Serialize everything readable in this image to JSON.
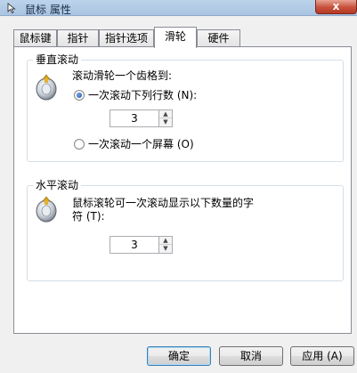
{
  "window": {
    "title": "鼠标 属性",
    "close_label": "x"
  },
  "tabs": [
    {
      "label": "鼠标键"
    },
    {
      "label": "指针"
    },
    {
      "label": "指针选项"
    },
    {
      "label": "滑轮",
      "active": true
    },
    {
      "label": "硬件"
    }
  ],
  "vertical": {
    "group_label": "垂直滚动",
    "description": "滚动滑轮一个齿格到:",
    "option_lines": "一次滚动下列行数 (N):",
    "lines_value": "3",
    "option_screen": "一次滚动一个屏幕 (O)",
    "selected": "lines"
  },
  "horizontal": {
    "group_label": "水平滚动",
    "description_line1": "鼠标滚轮可一次滚动显示以下数量的字",
    "description_line2": "符 (T):",
    "chars_value": "3"
  },
  "buttons": {
    "ok": "确定",
    "cancel": "取消",
    "apply": "应用 (A)"
  },
  "colors": {
    "accent": "#1d4f9b",
    "close": "#c7503c"
  }
}
